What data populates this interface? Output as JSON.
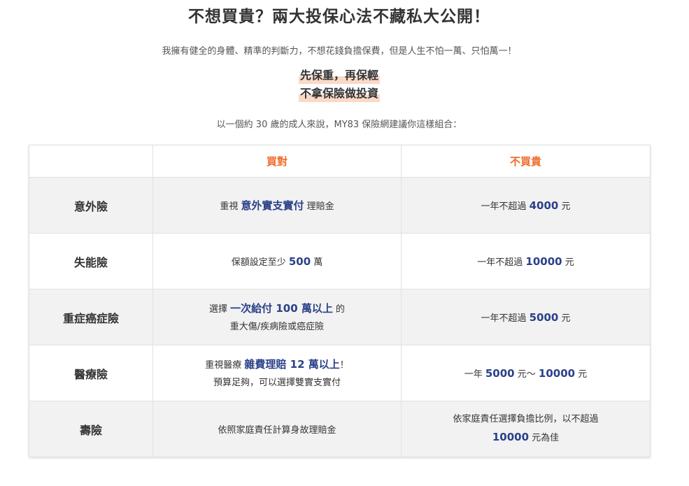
{
  "header": {
    "title": "不想買貴？兩大投保心法不藏私大公開！",
    "subtitle": "我擁有健全的身體、精準的判斷力，不想花錢負擔保費，但是人生不怕一萬、只怕萬一！",
    "highlight_1": "先保重，再保輕",
    "highlight_2": "不拿保險做投資",
    "intro": "以一個約 30 歲的成人來說，MY83 保險網建議你這樣組合："
  },
  "table": {
    "col_buy_right": "買對",
    "col_not_expensive": "不買貴",
    "rows": [
      {
        "name": "意外險",
        "buy": {
          "pre": "重視",
          "em": "意外實支實付",
          "post": "理賠金"
        },
        "cost": {
          "pre": "一年不超過",
          "em": "4000",
          "post": "元"
        }
      },
      {
        "name": "失能險",
        "buy": {
          "pre": "保額設定至少",
          "em": "500",
          "post": "萬"
        },
        "cost": {
          "pre": "一年不超過",
          "em": "10000",
          "post": "元"
        }
      },
      {
        "name": "重症癌症險",
        "buy": {
          "pre": "選擇",
          "em": "一次給付 100 萬以上",
          "post": "的",
          "line2": "重大傷/疾病險或癌症險"
        },
        "cost": {
          "pre": "一年不超過",
          "em": "5000",
          "post": "元"
        }
      },
      {
        "name": "醫療險",
        "buy": {
          "pre": "重視醫療",
          "em": "雜費理賠 12 萬以上",
          "post": "！",
          "line2": "預算足夠，可以選擇雙實支實付"
        },
        "cost": {
          "pre": "一年",
          "em": "5000",
          "mid": "元～",
          "em2": "10000",
          "post": "元"
        }
      },
      {
        "name": "壽險",
        "buy": {
          "text": "依照家庭責任計算身故理賠金"
        },
        "cost": {
          "line1": "依家庭責任選擇負擔比例，以不超過",
          "em": "10000",
          "post": "元為佳"
        }
      }
    ]
  }
}
